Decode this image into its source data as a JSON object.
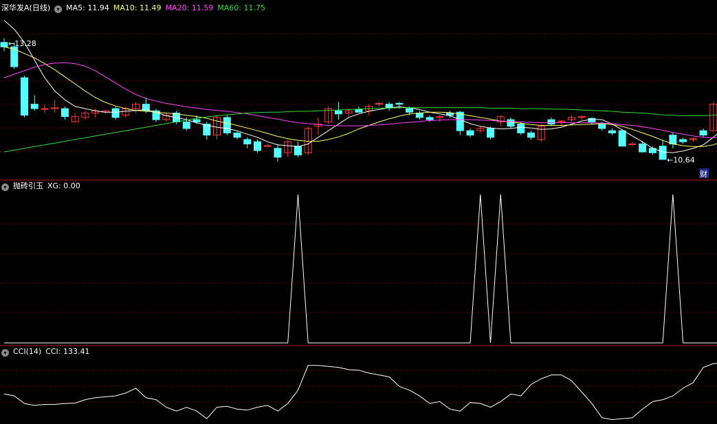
{
  "header": {
    "stock_name": "深华发A",
    "period": "(日线)",
    "ma5": "MA5: 11.94",
    "ma10": "MA10: 11.49",
    "ma20": "MA20: 11.59",
    "ma60": "MA60: 11.75",
    "panel2_title": "抛砖引玉",
    "panel2_value": "XG: 0.00",
    "panel3_title": "CCI(14)",
    "panel3_value": "CCI: 133.41",
    "chevron_icon": "chevron-down-icon"
  },
  "colors": {
    "background": "#000000",
    "up": "#ff3b3b",
    "down": "#55ffff",
    "ma5": "#ffffff",
    "ma10": "#ffff66",
    "ma20": "#ff44ff",
    "ma60": "#33dd33",
    "grid": "#7a1010",
    "divider": "#b01818",
    "indicator": "#ffffff"
  },
  "chart_data": [
    {
      "type": "candlestick",
      "title": "深华发A (日线)",
      "ylim": [
        10.4,
        13.95
      ],
      "annotations": [
        {
          "text": "13.28",
          "label": "period high"
        },
        {
          "text": "10.64",
          "label": "period low"
        },
        {
          "text": "财",
          "label": "financial report marker"
        }
      ],
      "ohlc": [
        [
          13.3,
          13.4,
          13.1,
          13.2
        ],
        [
          13.2,
          13.3,
          12.7,
          12.75
        ],
        [
          12.5,
          12.55,
          11.6,
          11.65
        ],
        [
          11.9,
          12.1,
          11.75,
          11.8
        ],
        [
          11.8,
          11.9,
          11.7,
          11.8
        ],
        [
          11.8,
          12.0,
          11.7,
          11.82
        ],
        [
          11.8,
          11.85,
          11.55,
          11.62
        ],
        [
          11.5,
          11.7,
          11.5,
          11.62
        ],
        [
          11.6,
          11.75,
          11.55,
          11.7
        ],
        [
          11.7,
          11.8,
          11.6,
          11.75
        ],
        [
          11.72,
          11.78,
          11.68,
          11.75
        ],
        [
          11.8,
          11.85,
          11.55,
          11.6
        ],
        [
          11.65,
          11.85,
          11.6,
          11.8
        ],
        [
          11.8,
          11.95,
          11.7,
          11.9
        ],
        [
          11.9,
          12.05,
          11.7,
          11.75
        ],
        [
          11.75,
          11.8,
          11.5,
          11.55
        ],
        [
          11.55,
          11.7,
          11.5,
          11.65
        ],
        [
          11.7,
          11.75,
          11.45,
          11.5
        ],
        [
          11.5,
          11.6,
          11.3,
          11.35
        ],
        [
          11.55,
          11.65,
          11.45,
          11.5
        ],
        [
          11.45,
          11.5,
          11.1,
          11.2
        ],
        [
          11.2,
          11.65,
          11.1,
          11.6
        ],
        [
          11.6,
          11.65,
          11.2,
          11.25
        ],
        [
          11.25,
          11.3,
          11.1,
          11.15
        ],
        [
          11.1,
          11.15,
          10.9,
          11.0
        ],
        [
          11.05,
          11.1,
          10.8,
          10.85
        ],
        [
          10.95,
          11.0,
          10.95,
          10.96
        ],
        [
          10.9,
          11.0,
          10.6,
          10.7
        ],
        [
          10.8,
          11.1,
          10.7,
          11.05
        ],
        [
          10.95,
          11.05,
          10.7,
          10.75
        ],
        [
          10.8,
          11.4,
          10.75,
          11.35
        ],
        [
          11.4,
          11.6,
          11.2,
          11.45
        ],
        [
          11.5,
          11.85,
          11.45,
          11.8
        ],
        [
          11.75,
          11.95,
          11.55,
          11.68
        ],
        [
          11.7,
          11.8,
          11.62,
          11.75
        ],
        [
          11.78,
          11.85,
          11.7,
          11.72
        ],
        [
          11.75,
          11.9,
          11.65,
          11.85
        ],
        [
          11.9,
          11.95,
          11.85,
          11.92
        ],
        [
          11.9,
          11.95,
          11.75,
          11.82
        ],
        [
          11.92,
          11.95,
          11.8,
          11.9
        ],
        [
          11.8,
          11.85,
          11.65,
          11.72
        ],
        [
          11.7,
          11.75,
          11.55,
          11.6
        ],
        [
          11.6,
          11.65,
          11.5,
          11.55
        ],
        [
          11.6,
          11.65,
          11.5,
          11.62
        ],
        [
          11.7,
          11.75,
          11.6,
          11.65
        ],
        [
          11.72,
          11.75,
          11.2,
          11.3
        ],
        [
          11.3,
          11.35,
          11.15,
          11.2
        ],
        [
          11.3,
          11.4,
          11.25,
          11.35
        ],
        [
          11.35,
          11.4,
          11.1,
          11.15
        ],
        [
          11.5,
          11.65,
          11.4,
          11.62
        ],
        [
          11.55,
          11.6,
          11.35,
          11.4
        ],
        [
          11.45,
          11.5,
          11.2,
          11.25
        ],
        [
          11.25,
          11.3,
          11.1,
          11.15
        ],
        [
          11.1,
          11.45,
          11.05,
          11.4
        ],
        [
          11.55,
          11.6,
          11.4,
          11.45
        ],
        [
          11.5,
          11.55,
          11.4,
          11.52
        ],
        [
          11.55,
          11.65,
          11.5,
          11.6
        ],
        [
          11.6,
          11.65,
          11.55,
          11.62
        ],
        [
          11.58,
          11.6,
          11.45,
          11.5
        ],
        [
          11.45,
          11.5,
          11.3,
          11.35
        ],
        [
          11.3,
          11.35,
          11.2,
          11.25
        ],
        [
          11.3,
          11.32,
          10.95,
          10.95
        ],
        [
          11.0,
          11.05,
          10.95,
          11.0
        ],
        [
          11.0,
          11.05,
          10.8,
          10.82
        ],
        [
          10.9,
          10.95,
          10.75,
          10.8
        ],
        [
          10.95,
          11.1,
          10.64,
          10.65
        ],
        [
          11.2,
          11.25,
          10.9,
          11.0
        ],
        [
          11.1,
          11.15,
          11.0,
          11.05
        ],
        [
          11.1,
          11.15,
          11.05,
          11.12
        ],
        [
          11.3,
          11.35,
          11.15,
          11.2
        ],
        [
          11.3,
          11.95,
          11.28,
          11.9
        ],
        [
          11.95,
          12.05,
          11.9,
          12.02
        ],
        [
          12.05,
          12.1,
          11.9,
          11.95
        ]
      ],
      "series": [
        {
          "name": "MA5",
          "values": [
            13.8,
            13.6,
            13.3,
            12.9,
            12.5,
            12.2,
            12.0,
            11.85,
            11.8,
            11.75,
            11.72,
            11.72,
            11.74,
            11.76,
            11.78,
            11.72,
            11.64,
            11.6,
            11.55,
            11.48,
            11.42,
            11.38,
            11.35,
            11.3,
            11.22,
            11.15,
            11.05,
            10.98,
            10.96,
            10.94,
            11.0,
            11.15,
            11.3,
            11.45,
            11.6,
            11.68,
            11.74,
            11.78,
            11.82,
            11.84,
            11.82,
            11.78,
            11.72,
            11.68,
            11.64,
            11.55,
            11.46,
            11.4,
            11.36,
            11.34,
            11.35,
            11.38,
            11.36,
            11.33,
            11.34,
            11.38,
            11.45,
            11.52,
            11.56,
            11.55,
            11.45,
            11.32,
            11.18,
            11.05,
            10.9,
            10.82,
            10.8,
            10.84,
            10.9,
            10.98,
            11.15,
            11.35,
            11.52
          ]
        },
        {
          "name": "MA10",
          "values": [
            13.2,
            13.15,
            13.05,
            12.95,
            12.82,
            12.68,
            12.52,
            12.36,
            12.2,
            12.05,
            11.94,
            11.86,
            11.8,
            11.76,
            11.74,
            11.72,
            11.7,
            11.68,
            11.65,
            11.62,
            11.58,
            11.52,
            11.47,
            11.42,
            11.36,
            11.3,
            11.24,
            11.17,
            11.12,
            11.08,
            11.06,
            11.06,
            11.1,
            11.16,
            11.24,
            11.34,
            11.42,
            11.5,
            11.57,
            11.63,
            11.68,
            11.7,
            11.72,
            11.72,
            11.71,
            11.68,
            11.64,
            11.6,
            11.56,
            11.52,
            11.5,
            11.47,
            11.44,
            11.42,
            11.42,
            11.42,
            11.43,
            11.44,
            11.45,
            11.46,
            11.44,
            11.4,
            11.33,
            11.25,
            11.17,
            11.08,
            11.0,
            10.96,
            10.94,
            10.94,
            10.98,
            11.06,
            11.16
          ]
        },
        {
          "name": "MA20",
          "values": [
            12.5,
            12.58,
            12.66,
            12.74,
            12.8,
            12.83,
            12.84,
            12.82,
            12.76,
            12.66,
            12.52,
            12.38,
            12.24,
            12.12,
            12.03,
            11.97,
            11.92,
            11.88,
            11.84,
            11.81,
            11.78,
            11.76,
            11.74,
            11.71,
            11.68,
            11.64,
            11.6,
            11.56,
            11.52,
            11.48,
            11.46,
            11.44,
            11.42,
            11.41,
            11.41,
            11.41,
            11.42,
            11.43,
            11.45,
            11.47,
            11.49,
            11.51,
            11.53,
            11.54,
            11.55,
            11.55,
            11.55,
            11.54,
            11.53,
            11.52,
            11.51,
            11.5,
            11.49,
            11.48,
            11.48,
            11.48,
            11.48,
            11.48,
            11.48,
            11.47,
            11.46,
            11.44,
            11.42,
            11.39,
            11.35,
            11.31,
            11.26,
            11.22,
            11.18,
            11.15,
            11.14,
            11.14,
            11.16
          ]
        },
        {
          "name": "MA60",
          "values": [
            10.82,
            10.86,
            10.9,
            10.94,
            10.98,
            11.02,
            11.06,
            11.1,
            11.14,
            11.18,
            11.22,
            11.26,
            11.3,
            11.34,
            11.38,
            11.42,
            11.46,
            11.5,
            11.54,
            11.58,
            11.61,
            11.64,
            11.66,
            11.68,
            11.7,
            11.71,
            11.72,
            11.72,
            11.73,
            11.74,
            11.74,
            11.75,
            11.76,
            11.77,
            11.78,
            11.79,
            11.8,
            11.81,
            11.81,
            11.82,
            11.82,
            11.82,
            11.82,
            11.82,
            11.82,
            11.82,
            11.82,
            11.82,
            11.81,
            11.81,
            11.81,
            11.8,
            11.8,
            11.8,
            11.79,
            11.79,
            11.78,
            11.77,
            11.76,
            11.75,
            11.74,
            11.72,
            11.71,
            11.7,
            11.68,
            11.66,
            11.65,
            11.64,
            11.64,
            11.64,
            11.65,
            11.68,
            11.71
          ]
        }
      ]
    },
    {
      "type": "line",
      "title": "抛砖引玉",
      "ylim": [
        0,
        1
      ],
      "series": [
        {
          "name": "XG",
          "values": [
            0,
            0,
            0,
            0,
            0,
            0,
            0,
            0,
            0,
            0,
            0,
            0,
            0,
            0,
            0,
            0,
            0,
            0,
            0,
            0,
            0,
            0,
            0,
            0,
            0,
            0,
            0,
            0,
            0,
            1,
            0,
            0,
            0,
            0,
            0,
            0,
            0,
            0,
            0,
            0,
            0,
            0,
            0,
            0,
            0,
            0,
            0,
            1,
            0,
            1,
            0,
            0,
            0,
            0,
            0,
            0,
            0,
            0,
            0,
            0,
            0,
            0,
            0,
            0,
            0,
            0,
            1,
            0,
            0,
            0,
            0,
            0,
            0
          ]
        }
      ]
    },
    {
      "type": "line",
      "title": "CCI(14)",
      "ylim": [
        -170,
        170
      ],
      "series": [
        {
          "name": "CCI",
          "values": [
            -30,
            -40,
            -80,
            -90,
            -85,
            -85,
            -80,
            -78,
            -60,
            -50,
            -45,
            -40,
            -25,
            0,
            -50,
            -60,
            -100,
            -120,
            -100,
            -120,
            -160,
            -100,
            -95,
            -110,
            -115,
            -100,
            -90,
            -120,
            -80,
            -10,
            120,
            120,
            115,
            110,
            98,
            95,
            80,
            70,
            60,
            10,
            -10,
            -40,
            -80,
            -70,
            -110,
            -120,
            -75,
            -80,
            -100,
            -70,
            -30,
            -40,
            20,
            50,
            70,
            70,
            40,
            -20,
            -80,
            -155,
            -165,
            -160,
            -155,
            -110,
            -70,
            -60,
            -40,
            0,
            30,
            110,
            130,
            133,
            133.41
          ]
        }
      ]
    }
  ]
}
